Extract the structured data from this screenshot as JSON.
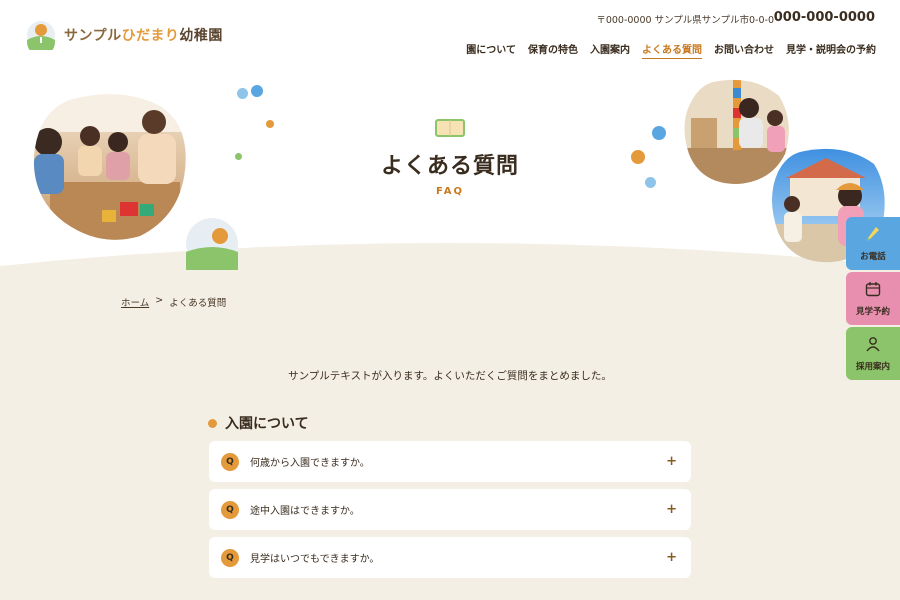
{
  "header": {
    "logo": {
      "part1": "サンプル",
      "part2": "ひだまり",
      "part3": "幼稚園"
    },
    "address": "〒000-0000 サンプル県サンプル市0-0-0",
    "phone": "000-000-0000",
    "nav": [
      {
        "label": "園について"
      },
      {
        "label": "保育の特色"
      },
      {
        "label": "入園案内"
      },
      {
        "label": "よくある質問"
      },
      {
        "label": "お問い合わせ"
      },
      {
        "label": "見学・説明会の予約"
      }
    ]
  },
  "hero": {
    "title": "よくある質問",
    "subtitle": "FAQ"
  },
  "breadcrumb": {
    "home": "ホーム",
    "separator": ">",
    "current": "よくある質問"
  },
  "intro": "サンプルテキストが入ります。よくいただくご質問をまとめました。",
  "section": {
    "heading": "入園について",
    "faqs": [
      {
        "badge": "Q",
        "question": "何歳から入園できますか。",
        "toggle": "+"
      },
      {
        "badge": "Q",
        "question": "途中入園はできますか。",
        "toggle": "+"
      },
      {
        "badge": "Q",
        "question": "見学はいつでもできますか。",
        "toggle": "+"
      }
    ]
  },
  "side_buttons": {
    "tel": "お電話",
    "visit": "見学予約",
    "recruit": "採用案内"
  },
  "colors": {
    "accent": "#e49a3a",
    "active_nav": "#c8791f",
    "background": "#f4efe4",
    "tel": "#5aa6e0",
    "visit": "#e88fb0",
    "recruit": "#8bc46a"
  }
}
